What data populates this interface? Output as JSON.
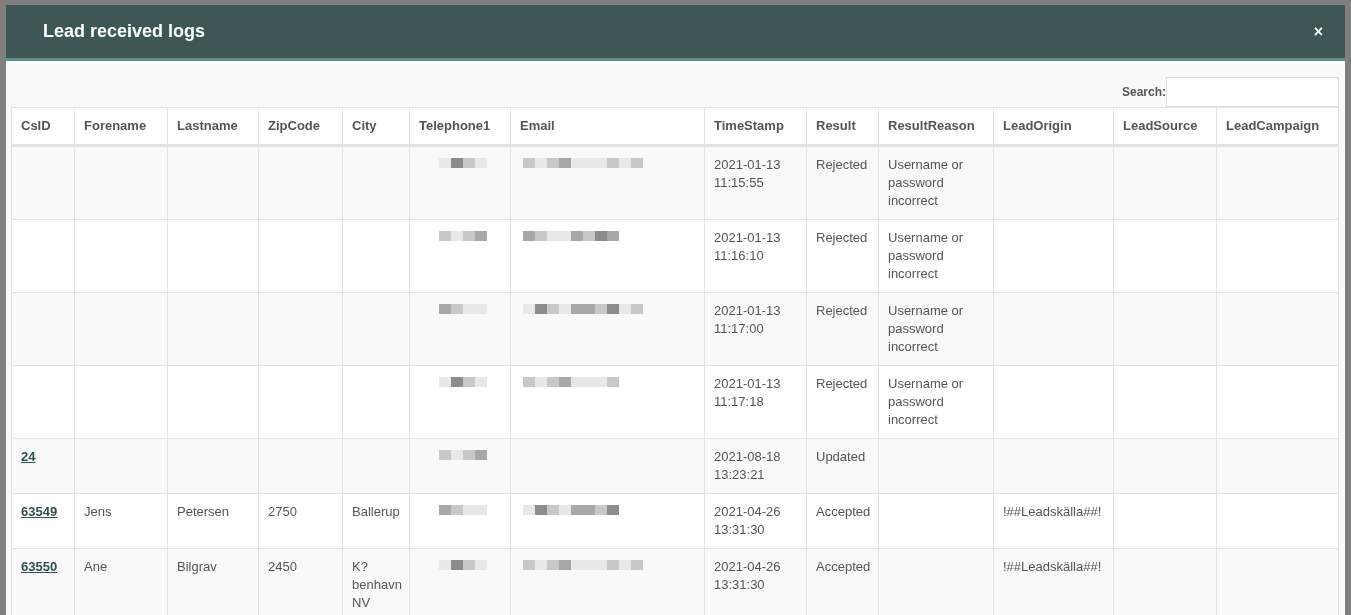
{
  "dialog": {
    "title": "Lead received logs",
    "close": "×"
  },
  "search": {
    "label": "Search:"
  },
  "table": {
    "columns": [
      "CsID",
      "Forename",
      "Lastname",
      "ZipCode",
      "City",
      "Telephone1",
      "Email",
      "TimeStamp",
      "Result",
      "ResultReason",
      "LeadOrigin",
      "LeadSource",
      "LeadCampaign"
    ],
    "rows": [
      {
        "cells": [
          null,
          null,
          null,
          null,
          null,
          {
            "kind": "redacted"
          },
          {
            "kind": "redacted"
          },
          "2021-01-13 11:15:55",
          "Rejected",
          "Username or password incorrect",
          null,
          null,
          null
        ]
      },
      {
        "cells": [
          null,
          null,
          null,
          null,
          null,
          {
            "kind": "redacted"
          },
          {
            "kind": "redacted"
          },
          "2021-01-13 11:16:10",
          "Rejected",
          "Username or password incorrect",
          null,
          null,
          null
        ]
      },
      {
        "cells": [
          null,
          null,
          null,
          null,
          null,
          {
            "kind": "redacted"
          },
          {
            "kind": "redacted"
          },
          "2021-01-13 11:17:00",
          "Rejected",
          "Username or password incorrect",
          null,
          null,
          null
        ]
      },
      {
        "cells": [
          null,
          null,
          null,
          null,
          null,
          {
            "kind": "redacted"
          },
          {
            "kind": "redacted"
          },
          "2021-01-13 11:17:18",
          "Rejected",
          "Username or password incorrect",
          null,
          null,
          null
        ]
      },
      {
        "cells": [
          "24",
          null,
          null,
          null,
          null,
          {
            "kind": "redacted"
          },
          null,
          "2021-08-18 13:23:21",
          "Updated",
          null,
          null,
          null,
          null
        ]
      },
      {
        "cells": [
          "63549",
          "Jens",
          "Petersen",
          "2750",
          "Ballerup",
          {
            "kind": "redacted"
          },
          {
            "kind": "redacted"
          },
          "2021-04-26 13:31:30",
          "Accepted",
          null,
          "!##Leadskälla##!",
          null,
          null
        ]
      },
      {
        "cells": [
          "63550",
          "Ane",
          "Bilgrav",
          "2450",
          "K? benhavn NV",
          {
            "kind": "redacted"
          },
          {
            "kind": "redacted"
          },
          "2021-04-26 13:31:30",
          "Accepted",
          null,
          "!##Leadskälla##!",
          null,
          null
        ]
      }
    ]
  }
}
